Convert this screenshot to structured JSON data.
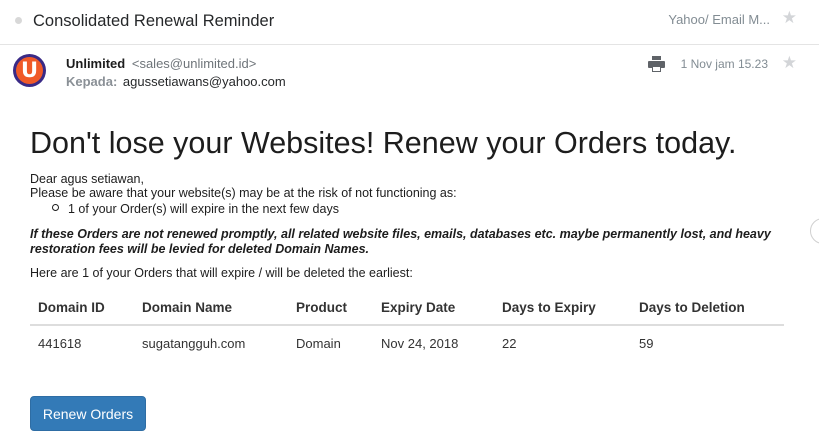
{
  "header": {
    "subject": "Consolidated Renewal Reminder",
    "folder": "Yahoo/ Email M...",
    "star_icon": "star-icon"
  },
  "message": {
    "sender_name": "Unlimited",
    "sender_email": "<sales@unlimited.id>",
    "to_label": "Kepada:",
    "to_value": "agussetiawans@yahoo.com",
    "date": "1 Nov jam 15.23",
    "avatar_letter": "U",
    "print_icon": "print-icon",
    "colors": {
      "avatar_bg": "#3a2a86",
      "avatar_ring": "#f05a28"
    }
  },
  "body": {
    "headline": "Don't lose your Websites! Renew your Orders today.",
    "greeting": "Dear agus setiawan,",
    "aware": "Please be aware that your website(s) may be at the risk of not functioning as:",
    "bullet": "1 of your Order(s) will expire in the next few days",
    "warning": "If these Orders are not renewed promptly, all related website files, emails, databases etc. maybe permanently lost, and heavy restoration fees will be levied for deleted Domain Names.",
    "intro": "Here are 1 of your Orders that will expire / will be deleted the earliest:",
    "table": {
      "headers": [
        "Domain ID",
        "Domain Name",
        "Product",
        "Expiry Date",
        "Days to Expiry",
        "Days to Deletion"
      ],
      "rows": [
        [
          "441618",
          "sugatangguh.com",
          "Domain",
          "Nov 24, 2018",
          "22",
          "59"
        ]
      ]
    },
    "renew_button": "Renew Orders",
    "colors": {
      "button": "#337ab7"
    }
  }
}
